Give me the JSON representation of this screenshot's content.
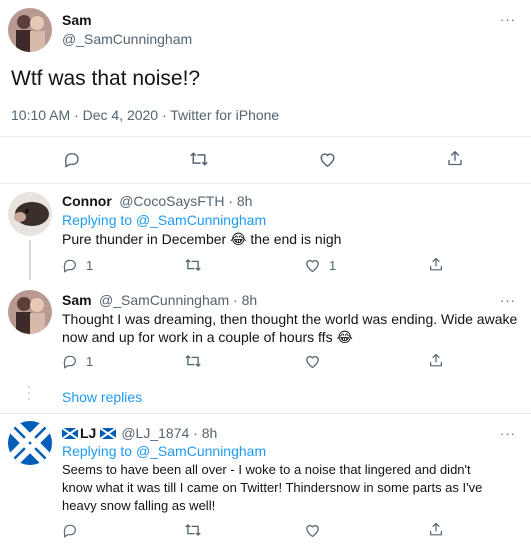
{
  "main_tweet": {
    "name": "Sam",
    "handle": "@_SamCunningham",
    "text": "Wtf was that noise!?",
    "meta": "10:10 AM · Dec 4, 2020 · Twitter for iPhone",
    "more_label": "···"
  },
  "replies": [
    {
      "name": "Connor",
      "handle_time": "@CocoSaysFTH · 8h",
      "replying_prefix": "Replying to ",
      "replying_handle": "@_SamCunningham",
      "text": "Pure thunder in December 😂 the end is nigh",
      "reply_count": "1",
      "like_count": "1"
    },
    {
      "name": "Sam",
      "handle_time": "@_SamCunningham · 8h",
      "more_label": "···",
      "text_line1": "Thought I was dreaming, then thought the world was ending. Wide awake",
      "text_line2": "now and up for work in a couple of hours ffs 😂",
      "reply_count": "1",
      "show_replies": "Show replies"
    },
    {
      "name": "LJ",
      "flag": "🏴",
      "handle_time": "@LJ_1874 · 8h",
      "more_label": "···",
      "replying_prefix": "Replying to ",
      "replying_handle": "@_SamCunningham",
      "text_line1": "Seems to have been all over - I woke to a noise that lingered and didn't",
      "text_line2": "know what it was till I came on Twitter! Thindersnow in some parts as I've",
      "text_line3": "heavy snow falling as well!"
    }
  ],
  "colors": {
    "accent": "#1d9bf0",
    "muted": "#536471",
    "divider": "#e6ecf0",
    "flag_blue": "#005eb8"
  },
  "icons": [
    "reply-icon",
    "retweet-icon",
    "like-icon",
    "share-icon",
    "more-icon",
    "scotland-flag-icon"
  ]
}
